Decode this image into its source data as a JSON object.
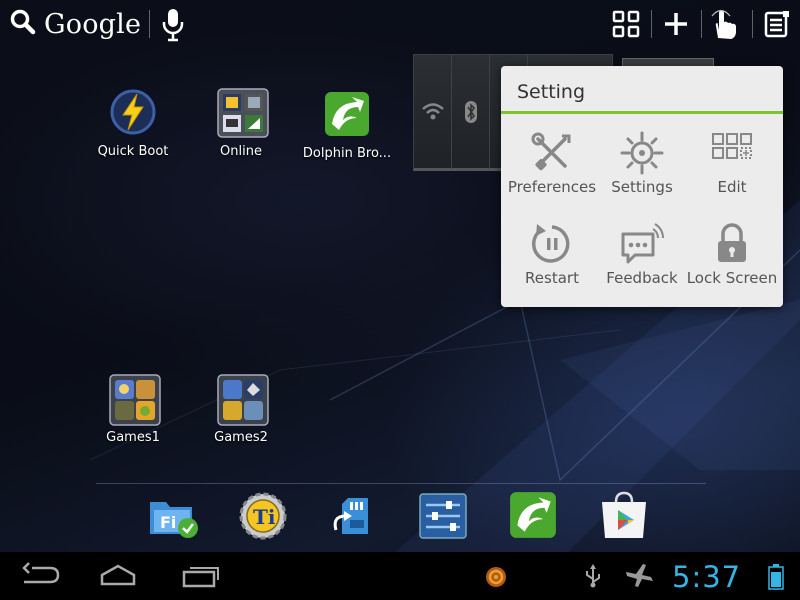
{
  "topbar": {
    "search_label": "Google",
    "icons": [
      "search-icon",
      "mic-icon",
      "apps-grid-icon",
      "add-icon",
      "touch-icon",
      "menu-icon"
    ]
  },
  "desktop": {
    "apps": [
      {
        "label": "Quick Boot",
        "icon": "lightning-icon"
      },
      {
        "label": "Online",
        "icon": "folder-icon"
      },
      {
        "label": "Dolphin Bro...",
        "icon": "dolphin-icon"
      },
      {
        "label": "Games1",
        "icon": "folder-icon"
      },
      {
        "label": "Games2",
        "icon": "folder-icon"
      }
    ]
  },
  "popup": {
    "title": "Setting",
    "accent": "#7fc32f",
    "items": [
      {
        "label": "Preferences",
        "icon": "tools-icon"
      },
      {
        "label": "Settings",
        "icon": "gear-icon"
      },
      {
        "label": "Edit",
        "icon": "grid-edit-icon"
      },
      {
        "label": "Restart",
        "icon": "restart-icon"
      },
      {
        "label": "Feedback",
        "icon": "feedback-icon"
      },
      {
        "label": "Lock Screen",
        "icon": "lock-icon"
      }
    ]
  },
  "dock": {
    "icons": [
      "file-explorer-icon",
      "titanium-backup-icon",
      "sd-card-icon",
      "settings-sliders-icon",
      "dolphin-icon",
      "play-store-icon"
    ]
  },
  "statusbar": {
    "time": "5:37",
    "time_color": "#33b5e5",
    "icons": [
      "back-icon",
      "home-icon",
      "recent-apps-icon",
      "notification-app-icon",
      "usb-icon",
      "airplane-mode-icon",
      "battery-icon"
    ]
  }
}
